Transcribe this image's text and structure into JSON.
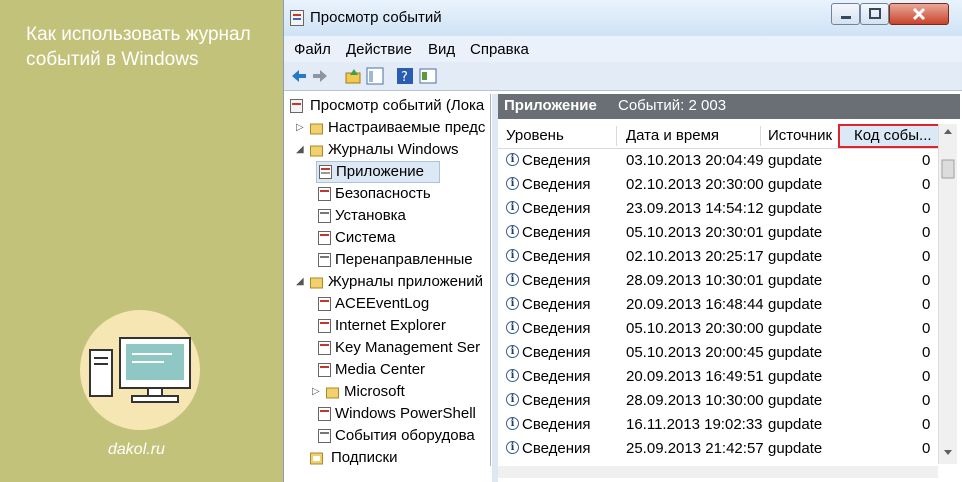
{
  "promo": {
    "title": "Как использовать журнал событий в Windows",
    "site": "dakol.ru"
  },
  "window": {
    "title": "Просмотр событий",
    "controls": {
      "minimize": "minimize-icon",
      "maximize": "maximize-icon",
      "close": "close-icon"
    }
  },
  "menu": {
    "items": [
      "Файл",
      "Действие",
      "Вид",
      "Справка"
    ]
  },
  "toolbar": {
    "icons": [
      "back-icon",
      "forward-icon",
      "up-icon",
      "show-hide-tree-icon",
      "help-icon",
      "properties-icon"
    ]
  },
  "tree": {
    "items": [
      {
        "label": "Просмотр событий (Лока"
      },
      {
        "label": "Настраиваемые предс"
      },
      {
        "label": "Журналы Windows"
      },
      {
        "label": "Приложение"
      },
      {
        "label": "Безопасность"
      },
      {
        "label": "Установка"
      },
      {
        "label": "Система"
      },
      {
        "label": "Перенаправленные"
      },
      {
        "label": "Журналы приложений"
      },
      {
        "label": "ACEEventLog"
      },
      {
        "label": "Internet Explorer"
      },
      {
        "label": "Key Management Ser"
      },
      {
        "label": "Media Center"
      },
      {
        "label": "Microsoft"
      },
      {
        "label": "Windows PowerShell"
      },
      {
        "label": "События оборудова"
      },
      {
        "label": "Подписки"
      }
    ]
  },
  "panel": {
    "title": "Приложение",
    "count": "Событий: 2 003",
    "columns": [
      "Уровень",
      "Дата и время",
      "Источник",
      "Код собы..."
    ],
    "rows": [
      {
        "level": "Сведения",
        "date": "03.10.2013 20:04:49",
        "source": "gupdate",
        "code": "0"
      },
      {
        "level": "Сведения",
        "date": "02.10.2013 20:30:00",
        "source": "gupdate",
        "code": "0"
      },
      {
        "level": "Сведения",
        "date": "23.09.2013 14:54:12",
        "source": "gupdate",
        "code": "0"
      },
      {
        "level": "Сведения",
        "date": "05.10.2013 20:30:01",
        "source": "gupdate",
        "code": "0"
      },
      {
        "level": "Сведения",
        "date": "02.10.2013 20:25:17",
        "source": "gupdate",
        "code": "0"
      },
      {
        "level": "Сведения",
        "date": "28.09.2013 10:30:01",
        "source": "gupdate",
        "code": "0"
      },
      {
        "level": "Сведения",
        "date": "20.09.2013 16:48:44",
        "source": "gupdate",
        "code": "0"
      },
      {
        "level": "Сведения",
        "date": "05.10.2013 20:30:00",
        "source": "gupdate",
        "code": "0"
      },
      {
        "level": "Сведения",
        "date": "05.10.2013 20:00:45",
        "source": "gupdate",
        "code": "0"
      },
      {
        "level": "Сведения",
        "date": "20.09.2013 16:49:51",
        "source": "gupdate",
        "code": "0"
      },
      {
        "level": "Сведения",
        "date": "28.09.2013 10:30:00",
        "source": "gupdate",
        "code": "0"
      },
      {
        "level": "Сведения",
        "date": "16.11.2013 19:02:33",
        "source": "gupdate",
        "code": "0"
      },
      {
        "level": "Сведения",
        "date": "25.09.2013 21:42:57",
        "source": "gupdate",
        "code": "0"
      }
    ]
  },
  "colors": {
    "highlight": "#e0242a",
    "promo_bg": "#c3c27b",
    "panel_header": "#6a6f75"
  }
}
